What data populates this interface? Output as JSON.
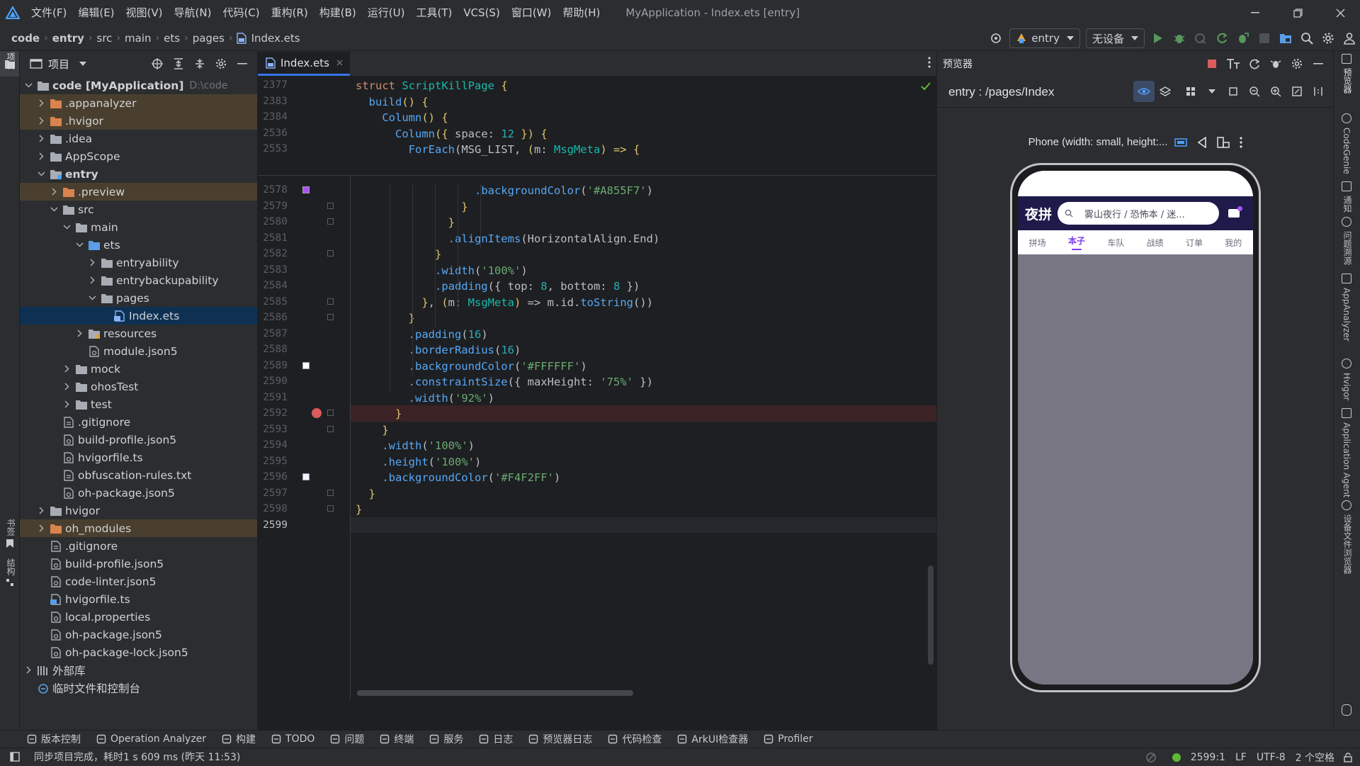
{
  "menu": [
    "文件(F)",
    "编辑(E)",
    "视图(V)",
    "导航(N)",
    "代码(C)",
    "重构(R)",
    "构建(B)",
    "运行(U)",
    "工具(T)",
    "VCS(S)",
    "窗口(W)",
    "帮助(H)"
  ],
  "window_title": "MyApplication - Index.ets [entry]",
  "breadcrumb": [
    "code",
    "entry",
    "src",
    "main",
    "ets",
    "pages",
    "Index.ets"
  ],
  "run_config": "entry",
  "device": "无设备",
  "project_panel": {
    "title": "项目",
    "tree": [
      {
        "label": "code [MyApplication]",
        "extra": "D:\\code",
        "depth": 0,
        "chev": "down",
        "icon": "folder",
        "bold": true
      },
      {
        "label": ".appanalyzer",
        "depth": 1,
        "chev": "right",
        "icon": "folder-orange",
        "hl": true
      },
      {
        "label": ".hvigor",
        "depth": 1,
        "chev": "right",
        "icon": "folder-orange",
        "hl": true
      },
      {
        "label": ".idea",
        "depth": 1,
        "chev": "right",
        "icon": "folder"
      },
      {
        "label": "AppScope",
        "depth": 1,
        "chev": "right",
        "icon": "folder"
      },
      {
        "label": "entry",
        "depth": 1,
        "chev": "down",
        "icon": "folder-module",
        "bold": true
      },
      {
        "label": ".preview",
        "depth": 2,
        "chev": "right",
        "icon": "folder-orange",
        "hl": true
      },
      {
        "label": "src",
        "depth": 2,
        "chev": "down",
        "icon": "folder"
      },
      {
        "label": "main",
        "depth": 3,
        "chev": "down",
        "icon": "folder"
      },
      {
        "label": "ets",
        "depth": 4,
        "chev": "down",
        "icon": "folder-blue"
      },
      {
        "label": "entryability",
        "depth": 5,
        "chev": "right",
        "icon": "folder"
      },
      {
        "label": "entrybackupability",
        "depth": 5,
        "chev": "right",
        "icon": "folder"
      },
      {
        "label": "pages",
        "depth": 5,
        "chev": "down",
        "icon": "folder"
      },
      {
        "label": "Index.ets",
        "depth": 6,
        "chev": "",
        "icon": "file-ets",
        "sel": true
      },
      {
        "label": "resources",
        "depth": 4,
        "chev": "right",
        "icon": "folder-res"
      },
      {
        "label": "module.json5",
        "depth": 4,
        "chev": "",
        "icon": "file-json"
      },
      {
        "label": "mock",
        "depth": 3,
        "chev": "right",
        "icon": "folder"
      },
      {
        "label": "ohosTest",
        "depth": 3,
        "chev": "right",
        "icon": "folder"
      },
      {
        "label": "test",
        "depth": 3,
        "chev": "right",
        "icon": "folder"
      },
      {
        "label": ".gitignore",
        "depth": 2,
        "chev": "",
        "icon": "file"
      },
      {
        "label": "build-profile.json5",
        "depth": 2,
        "chev": "",
        "icon": "file-json"
      },
      {
        "label": "hvigorfile.ts",
        "depth": 2,
        "chev": "",
        "icon": "file-json"
      },
      {
        "label": "obfuscation-rules.txt",
        "depth": 2,
        "chev": "",
        "icon": "file"
      },
      {
        "label": "oh-package.json5",
        "depth": 2,
        "chev": "",
        "icon": "file-json"
      },
      {
        "label": "hvigor",
        "depth": 1,
        "chev": "right",
        "icon": "folder"
      },
      {
        "label": "oh_modules",
        "depth": 1,
        "chev": "right",
        "icon": "folder-orange",
        "hl": true
      },
      {
        "label": ".gitignore",
        "depth": 1,
        "chev": "",
        "icon": "file"
      },
      {
        "label": "build-profile.json5",
        "depth": 1,
        "chev": "",
        "icon": "file-json"
      },
      {
        "label": "code-linter.json5",
        "depth": 1,
        "chev": "",
        "icon": "file-json"
      },
      {
        "label": "hvigorfile.ts",
        "depth": 1,
        "chev": "",
        "icon": "file-ts"
      },
      {
        "label": "local.properties",
        "depth": 1,
        "chev": "",
        "icon": "file-json"
      },
      {
        "label": "oh-package.json5",
        "depth": 1,
        "chev": "",
        "icon": "file-json"
      },
      {
        "label": "oh-package-lock.json5",
        "depth": 1,
        "chev": "",
        "icon": "file-json"
      },
      {
        "label": "外部库",
        "depth": 0,
        "chev": "right",
        "icon": "lib"
      },
      {
        "label": "临时文件和控制台",
        "depth": 0,
        "chev": "",
        "icon": "scratch"
      }
    ]
  },
  "editor": {
    "tab": "Index.ets",
    "sticky_lines": [
      {
        "num": "2377",
        "code": [
          [
            "k",
            "struct "
          ],
          [
            "t",
            "ScriptKillPage "
          ],
          [
            "o",
            "{"
          ]
        ]
      },
      {
        "num": "2383",
        "code": [
          [
            "w",
            "  "
          ],
          [
            "f",
            "build"
          ],
          [
            "o",
            "() {"
          ]
        ]
      },
      {
        "num": "2384",
        "code": [
          [
            "w",
            "    "
          ],
          [
            "f",
            "Column"
          ],
          [
            "o",
            "() {"
          ]
        ]
      },
      {
        "num": "2536",
        "code": [
          [
            "w",
            "      "
          ],
          [
            "f",
            "Column"
          ],
          [
            "o",
            "({ "
          ],
          [
            "w",
            "space: "
          ],
          [
            "n",
            "12"
          ],
          [
            "o",
            " }) {"
          ]
        ]
      },
      {
        "num": "2553",
        "code": [
          [
            "w",
            "        "
          ],
          [
            "f",
            "ForEach"
          ],
          [
            "w",
            "(MSG_LIST, "
          ],
          [
            "o",
            "("
          ],
          [
            "w",
            "m: "
          ],
          [
            "t",
            "MsgMeta"
          ],
          [
            "o",
            ") => {"
          ]
        ]
      }
    ],
    "lines": [
      {
        "num": "2578",
        "marker": "swatch-purple",
        "code": [
          [
            "w",
            "                  "
          ],
          [
            "f",
            ".backgroundColor"
          ],
          [
            "w",
            "("
          ],
          [
            "s",
            "'#A855F7'"
          ],
          [
            "w",
            ")"
          ]
        ]
      },
      {
        "num": "2579",
        "code": [
          [
            "o",
            "                }"
          ]
        ]
      },
      {
        "num": "2580",
        "code": [
          [
            "o",
            "              }"
          ]
        ]
      },
      {
        "num": "2581",
        "code": [
          [
            "w",
            "              "
          ],
          [
            "f",
            ".alignItems"
          ],
          [
            "w",
            "(HorizontalAlign.End)"
          ]
        ]
      },
      {
        "num": "2582",
        "code": [
          [
            "o",
            "            }"
          ]
        ]
      },
      {
        "num": "2583",
        "code": [
          [
            "w",
            "            "
          ],
          [
            "f",
            ".width"
          ],
          [
            "w",
            "("
          ],
          [
            "s",
            "'100%'"
          ],
          [
            "w",
            ")"
          ]
        ]
      },
      {
        "num": "2584",
        "code": [
          [
            "w",
            "            "
          ],
          [
            "f",
            ".padding"
          ],
          [
            "w",
            "({ top: "
          ],
          [
            "n",
            "8"
          ],
          [
            "w",
            ", bottom: "
          ],
          [
            "n",
            "8"
          ],
          [
            "w",
            " })"
          ]
        ]
      },
      {
        "num": "2585",
        "code": [
          [
            "o",
            "          }"
          ],
          [
            "w",
            ", "
          ],
          [
            "o",
            "("
          ],
          [
            "w",
            "m: "
          ],
          [
            "t",
            "MsgMeta"
          ],
          [
            "o",
            ")"
          ],
          [
            "w",
            " => m.id."
          ],
          [
            "f",
            "toString"
          ],
          [
            "w",
            "())"
          ]
        ]
      },
      {
        "num": "2586",
        "code": [
          [
            "o",
            "        }"
          ]
        ]
      },
      {
        "num": "2587",
        "code": [
          [
            "w",
            "        "
          ],
          [
            "f",
            ".padding"
          ],
          [
            "w",
            "("
          ],
          [
            "n",
            "16"
          ],
          [
            "w",
            ")"
          ]
        ]
      },
      {
        "num": "2588",
        "code": [
          [
            "w",
            "        "
          ],
          [
            "f",
            ".borderRadius"
          ],
          [
            "w",
            "("
          ],
          [
            "n",
            "16"
          ],
          [
            "w",
            ")"
          ]
        ]
      },
      {
        "num": "2589",
        "marker": "swatch-white",
        "code": [
          [
            "w",
            "        "
          ],
          [
            "f",
            ".backgroundColor"
          ],
          [
            "w",
            "("
          ],
          [
            "s",
            "'#FFFFFF'"
          ],
          [
            "w",
            ")"
          ]
        ]
      },
      {
        "num": "2590",
        "code": [
          [
            "w",
            "        "
          ],
          [
            "f",
            ".constraintSize"
          ],
          [
            "w",
            "({ maxHeight: "
          ],
          [
            "s",
            "'75%'"
          ],
          [
            "w",
            " })"
          ]
        ]
      },
      {
        "num": "2591",
        "code": [
          [
            "w",
            "        "
          ],
          [
            "f",
            ".width"
          ],
          [
            "w",
            "("
          ],
          [
            "s",
            "'92%'"
          ],
          [
            "w",
            ")"
          ]
        ]
      },
      {
        "num": "2592",
        "marker": "breakpoint",
        "code": [
          [
            "o",
            "      }"
          ]
        ]
      },
      {
        "num": "2593",
        "code": [
          [
            "o",
            "    }"
          ]
        ]
      },
      {
        "num": "2594",
        "code": [
          [
            "w",
            "    "
          ],
          [
            "f",
            ".width"
          ],
          [
            "w",
            "("
          ],
          [
            "s",
            "'100%'"
          ],
          [
            "w",
            ")"
          ]
        ]
      },
      {
        "num": "2595",
        "code": [
          [
            "w",
            "    "
          ],
          [
            "f",
            ".height"
          ],
          [
            "w",
            "("
          ],
          [
            "s",
            "'100%'"
          ],
          [
            "w",
            ")"
          ]
        ]
      },
      {
        "num": "2596",
        "marker": "swatch-light",
        "code": [
          [
            "w",
            "    "
          ],
          [
            "f",
            ".backgroundColor"
          ],
          [
            "w",
            "("
          ],
          [
            "s",
            "'#F4F2FF'"
          ],
          [
            "w",
            ")"
          ]
        ]
      },
      {
        "num": "2597",
        "code": [
          [
            "o",
            "  }"
          ]
        ]
      },
      {
        "num": "2598",
        "code": [
          [
            "o",
            "}"
          ]
        ]
      },
      {
        "num": "2599",
        "code": []
      }
    ]
  },
  "preview": {
    "title": "预览器",
    "route": "entry : /pages/Index",
    "device_label": "Phone (width: small, height:...",
    "app": {
      "logo": "夜拼",
      "search_placeholder": "雾山夜行 / 恐怖本 / 迷...",
      "tabs": [
        "拼场",
        "本子",
        "车队",
        "战绩",
        "订单",
        "我的"
      ],
      "active_tab": 1,
      "header_color": "#1e1b4b",
      "accent": "#7c3aed"
    }
  },
  "right_strip": [
    "预览器",
    "CodeGenie",
    "通知",
    "问题溯源",
    "AppAnalyzer",
    "Hvigor",
    "Application Agent",
    "设备文件浏览器"
  ],
  "left_strip_bottom": [
    "书签",
    "结构"
  ],
  "bottom_tools": [
    "版本控制",
    "Operation Analyzer",
    "构建",
    "TODO",
    "问题",
    "终端",
    "服务",
    "日志",
    "预览器日志",
    "代码检查",
    "ArkUI检查器",
    "Profiler"
  ],
  "status": {
    "message": "同步项目完成，耗时1 s 609 ms (昨天 11:53)",
    "position": "2599:1",
    "line_sep": "LF",
    "encoding": "UTF-8",
    "indent": "2 个空格"
  },
  "colors": {
    "breakpoint": "#db5c5c",
    "swatch_purple": "#A855F7",
    "swatch_white": "#FFFFFF",
    "swatch_light": "#F4F2FF",
    "status_ok": "#5fb832"
  }
}
